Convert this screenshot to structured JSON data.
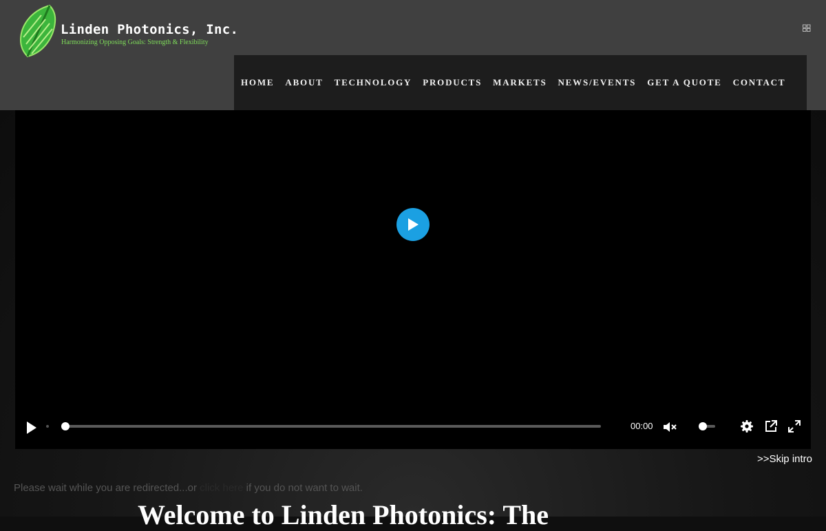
{
  "header": {
    "logo_name": "Linden Photonics, Inc.",
    "logo_tagline": "Harmonizing Opposing Goals: Strength & Flexibility",
    "apps_icon": "grid-icon"
  },
  "nav": {
    "items": [
      {
        "label": "HOME"
      },
      {
        "label": "ABOUT"
      },
      {
        "label": "TECHNOLOGY"
      },
      {
        "label": "PRODUCTS"
      },
      {
        "label": "MARKETS"
      },
      {
        "label": "NEWS/EVENTS"
      },
      {
        "label": "GET A QUOTE"
      },
      {
        "label": "CONTACT"
      }
    ]
  },
  "video": {
    "time": "00:00",
    "progress": 0,
    "volume": 0,
    "muted": true,
    "accent_color": "#1ba0e2",
    "icons": [
      "play-icon",
      "mute-icon",
      "settings-icon",
      "popout-icon",
      "fullscreen-icon"
    ]
  },
  "intro": {
    "skip_label": ">>Skip intro",
    "redirect_before": "Please wait while you are redirected...or ",
    "redirect_link": "click here",
    "redirect_after": " if you do not want to wait.",
    "welcome_title": "Welcome to Linden Photonics: The"
  },
  "colors": {
    "header_bg": "#404040",
    "nav_bg": "#1d1d1d",
    "tagline": "#7fdd5a",
    "leaf": "#3cb53c"
  }
}
